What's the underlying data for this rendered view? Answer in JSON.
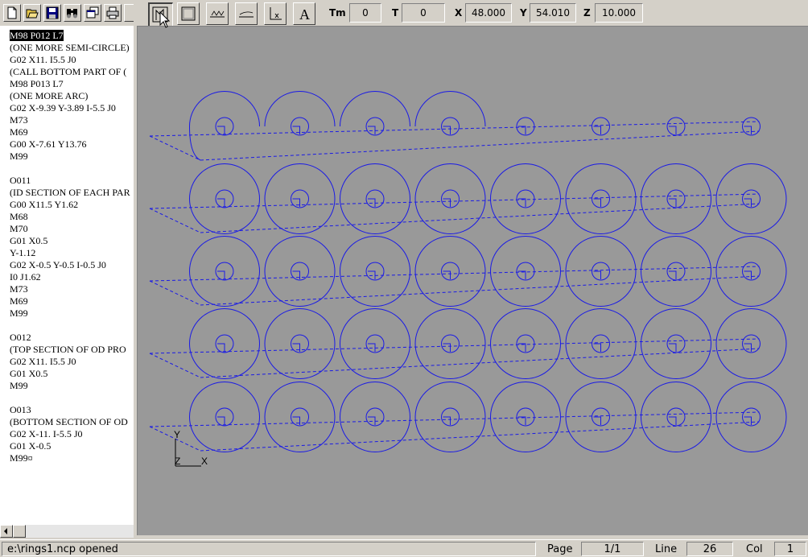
{
  "left_toolbar": {
    "icons": [
      "new-file-icon",
      "open-folder-icon",
      "save-icon",
      "find-icon",
      "copy-window-icon",
      "print-icon"
    ]
  },
  "code": {
    "lines": [
      "M98 P012 L7",
      "(ONE MORE SEMI-CIRCLE)",
      "G02 X11. I5.5 J0",
      "(CALL BOTTOM PART OF (",
      "M98 P013 L7",
      "(ONE MORE ARC)",
      "G02 X-9.39 Y-3.89 I-5.5 J0",
      "M73",
      "M69",
      "G00 X-7.61 Y13.76",
      "M99",
      "",
      "O011",
      "(ID SECTION OF EACH PAR",
      "G00 X11.5 Y1.62",
      "M68",
      "M70",
      "G01 X0.5",
      "Y-1.12",
      "G02 X-0.5 Y-0.5 I-0.5 J0",
      "I0 J1.62",
      "M73",
      "M69",
      "M99",
      "",
      "O012",
      "(TOP SECTION OF OD PRO",
      "G02 X11. I5.5 J0",
      "G01 X0.5",
      "M99",
      "",
      "O013",
      "(BOTTOM SECTION OF OD",
      "G02 X-11. I-5.5 J0",
      "G01 X-0.5",
      "M99¤"
    ],
    "selected_index": 0
  },
  "view_toolbar": {
    "buttons": [
      "toolpath-view-icon",
      "stock-view-icon",
      "xy-plot-icon",
      "xz-plot-icon",
      "axes-view-icon",
      "text-view-icon"
    ],
    "tm_label": "Tm",
    "tm_value": "0",
    "t_label": "T",
    "t_value": "0",
    "x_label": "X",
    "x_value": "48.000",
    "y_label": "Y",
    "y_value": "54.010",
    "z_label": "Z",
    "z_value": "10.000"
  },
  "plot": {
    "axis_y": "Y",
    "axis_x": "X",
    "axis_z": "Z",
    "line_color": "#1a1ae6",
    "background": "#999999",
    "columns": 8,
    "full_rows": 4,
    "top_row_semicircles": 4
  },
  "status": {
    "message": "e:\\rings1.ncp opened",
    "page_label": "Page",
    "page_value": "1/1",
    "line_label": "Line",
    "line_value": "26",
    "col_label": "Col",
    "col_value": "1"
  }
}
